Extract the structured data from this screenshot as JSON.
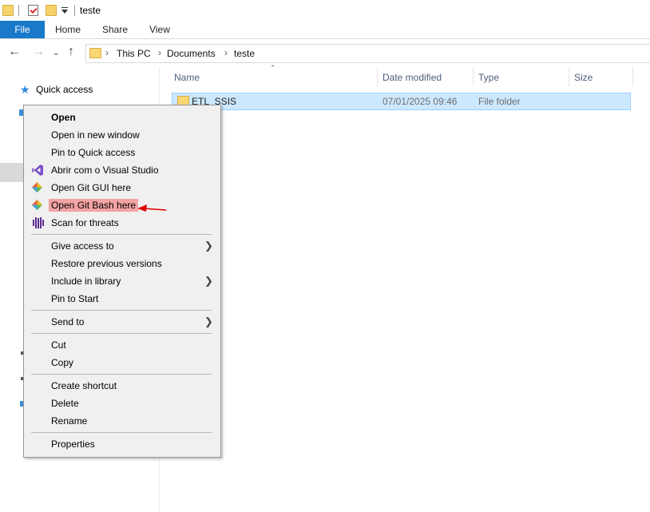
{
  "window": {
    "title": "teste"
  },
  "ribbon": {
    "tabs": [
      "File",
      "Home",
      "Share",
      "View"
    ]
  },
  "address": {
    "breadcrumbs": [
      "This PC",
      "Documents",
      "teste"
    ]
  },
  "navpane": {
    "quick_access": "Quick access"
  },
  "columns": {
    "name": "Name",
    "date_modified": "Date modified",
    "type": "Type",
    "size": "Size"
  },
  "files": [
    {
      "name": "ETL_SSIS",
      "date_modified": "07/01/2025 09:46",
      "type": "File folder",
      "size": ""
    }
  ],
  "context_menu": {
    "items": [
      {
        "label": "Open"
      },
      {
        "label": "Open in new window"
      },
      {
        "label": "Pin to Quick access"
      },
      {
        "label": "Abrir com o Visual Studio",
        "icon": "visual-studio-icon"
      },
      {
        "label": "Open Git GUI here",
        "icon": "git-gui-icon"
      },
      {
        "label": "Open Git Bash here",
        "icon": "git-bash-icon"
      },
      {
        "label": "Scan for threats",
        "icon": "defender-scan-icon"
      },
      {
        "label": "Give access to"
      },
      {
        "label": "Restore previous versions"
      },
      {
        "label": "Include in library"
      },
      {
        "label": "Pin to Start"
      },
      {
        "label": "Send to"
      },
      {
        "label": "Cut"
      },
      {
        "label": "Copy"
      },
      {
        "label": "Create shortcut"
      },
      {
        "label": "Delete"
      },
      {
        "label": "Rename"
      },
      {
        "label": "Properties"
      }
    ],
    "highlight_color": "#f3a3a3"
  },
  "colors": {
    "file_tab": "#1979ca",
    "selection_bg": "#cce8ff",
    "annotation_arrow": "#e00000"
  }
}
